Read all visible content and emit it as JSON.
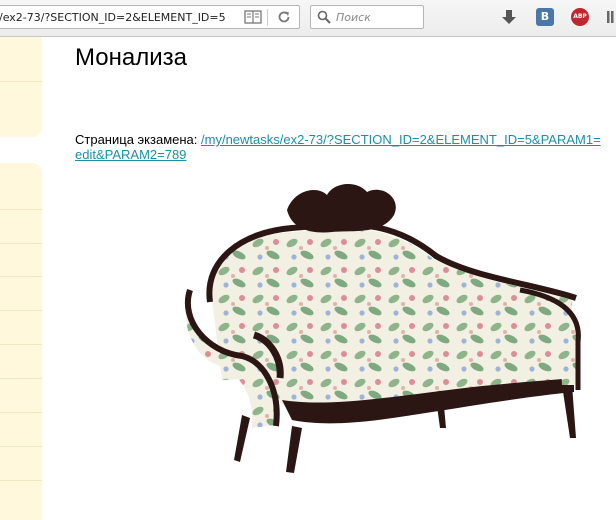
{
  "browser": {
    "url": "/ex2-73/?SECTION_ID=2&ELEMENT_ID=5",
    "search_placeholder": "Поиск",
    "icons": [
      "reader-view-icon",
      "reload-icon",
      "search-icon",
      "download-icon",
      "vk-icon",
      "adblock-icon",
      "library-icon"
    ],
    "vk_label": "B",
    "adblock_label": "ABP"
  },
  "main": {
    "title": "Монализа",
    "exam_label": "Страница экзамена:",
    "exam_link": "/my/newtasks/ex2-73/?SECTION_ID=2&ELEMENT_ID=5&PARAM1=edit&PARAM2=789"
  },
  "colors": {
    "sidebar_bg": "#fff8dc",
    "link": "#1a8fa6"
  }
}
